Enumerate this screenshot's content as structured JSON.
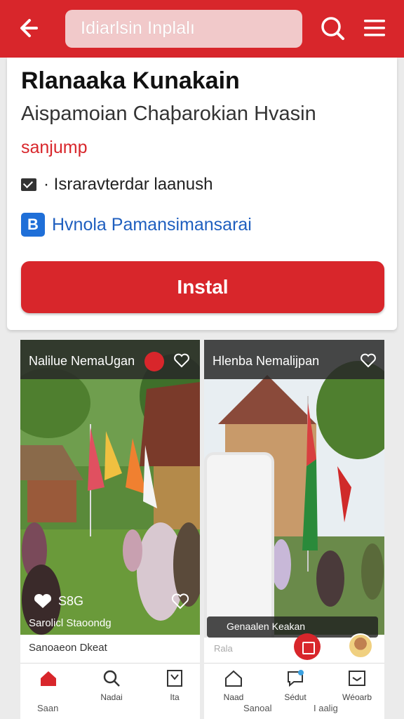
{
  "topbar": {
    "search_text": "Idiarlsin Inplalı",
    "back_icon": "arrow-left-icon",
    "search_icon": "search-icon",
    "menu_icon": "hamburger-menu-icon",
    "color": "#d8262b"
  },
  "app": {
    "title": "Rlanaaka Kunakain",
    "subtitle": "Aispamoian Chaþarokian Hvasin",
    "category": "sanjump",
    "email_text": "· Israravterdar laanush",
    "developer_badge": "B",
    "developer_text": "Hvnola Pamansimansarai",
    "install_label": "Instal"
  },
  "screenshots": {
    "left": {
      "title": "Nalilue NemaUgan",
      "like_count": "S8G",
      "caption": "Sarolicl Staoondg",
      "footer_text": "Sanoaeon Dkeat",
      "nav": [
        {
          "icon": "home-icon",
          "label": ""
        },
        {
          "icon": "search-icon",
          "label": "Nadai"
        },
        {
          "icon": "bookmark-icon",
          "label": "Ita"
        }
      ],
      "nav_row2": [
        "Saan",
        ""
      ]
    },
    "right": {
      "title": "Hlenba Nemalijpan",
      "chat_text": "Genaalen Keakan",
      "pale_label": "Rala",
      "nav": [
        {
          "icon": "home-icon",
          "label": "Naad"
        },
        {
          "icon": "chat-icon",
          "label": "Sédut"
        },
        {
          "icon": "inbox-icon",
          "label": "Wéoarb"
        }
      ],
      "nav_row2": [
        "Sanoal",
        "I aalig"
      ]
    }
  }
}
